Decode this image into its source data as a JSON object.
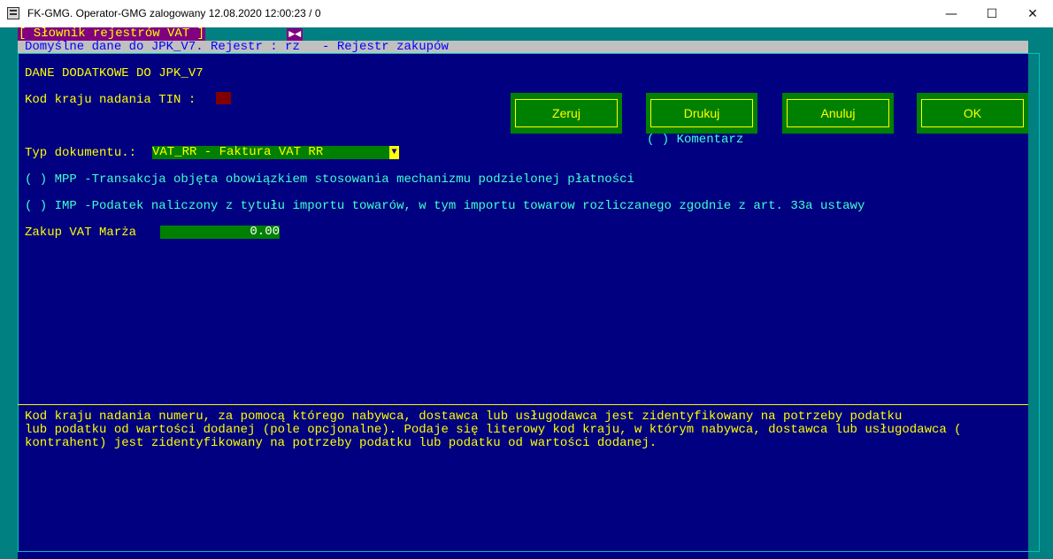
{
  "window": {
    "title": "FK-GMG. Operator-GMG zalogowany 12.08.2020 12:00:23 / 0",
    "minimize_glyph": "—",
    "maximize_glyph": "☐",
    "close_glyph": "✕"
  },
  "dialog": {
    "tab_label": "[ Słownik rejestrów VAT ]",
    "marker": "►◄",
    "subtitle": "Domyślne dane do JPK_V7. Rejestr : rz   - Rejestr zakupów"
  },
  "form": {
    "heading": "DANE DODATKOWE DO JPK_V7",
    "tin_label": "Kod kraju nadania TIN :",
    "typ_label": "Typ dokumentu.:",
    "typ_value": "VAT_RR - Faktura VAT RR",
    "typ_arrow": "▼",
    "mpp_text": "( ) MPP -Transakcja objęta obowiązkiem stosowania mechanizmu podzielonej płatności",
    "imp_text": "( ) IMP -Podatek naliczony z tytułu importu towarów, w tym importu towarow rozliczanego zgodnie z art. 33a ustawy",
    "zakup_label": "Zakup VAT Marża",
    "zakup_value": "0.00",
    "komentarz": "( ) Komentarz"
  },
  "buttons": {
    "zeruj": "Zeruj",
    "drukuj": "Drukuj",
    "anuluj": "Anuluj",
    "ok": "OK"
  },
  "help_lines": [
    "Kod kraju nadania numeru, za pomocą którego nabywca, dostawca lub usługodawca jest zidentyfikowany na potrzeby podatku",
    "lub podatku od wartości dodanej (pole opcjonalne). Podaje się literowy kod kraju, w którym nabywca, dostawca lub usługodawca (",
    "kontrahent) jest zidentyfikowany na potrzeby podatku lub podatku od wartości dodanej."
  ],
  "colors": {
    "console_bg": "#008080",
    "panel_bg": "#000080",
    "label_yellow": "#ffff00",
    "option_cyan": "#40ffd0",
    "field_green": "#008000",
    "tab_purple": "#800080",
    "tin_box": "#800000"
  }
}
